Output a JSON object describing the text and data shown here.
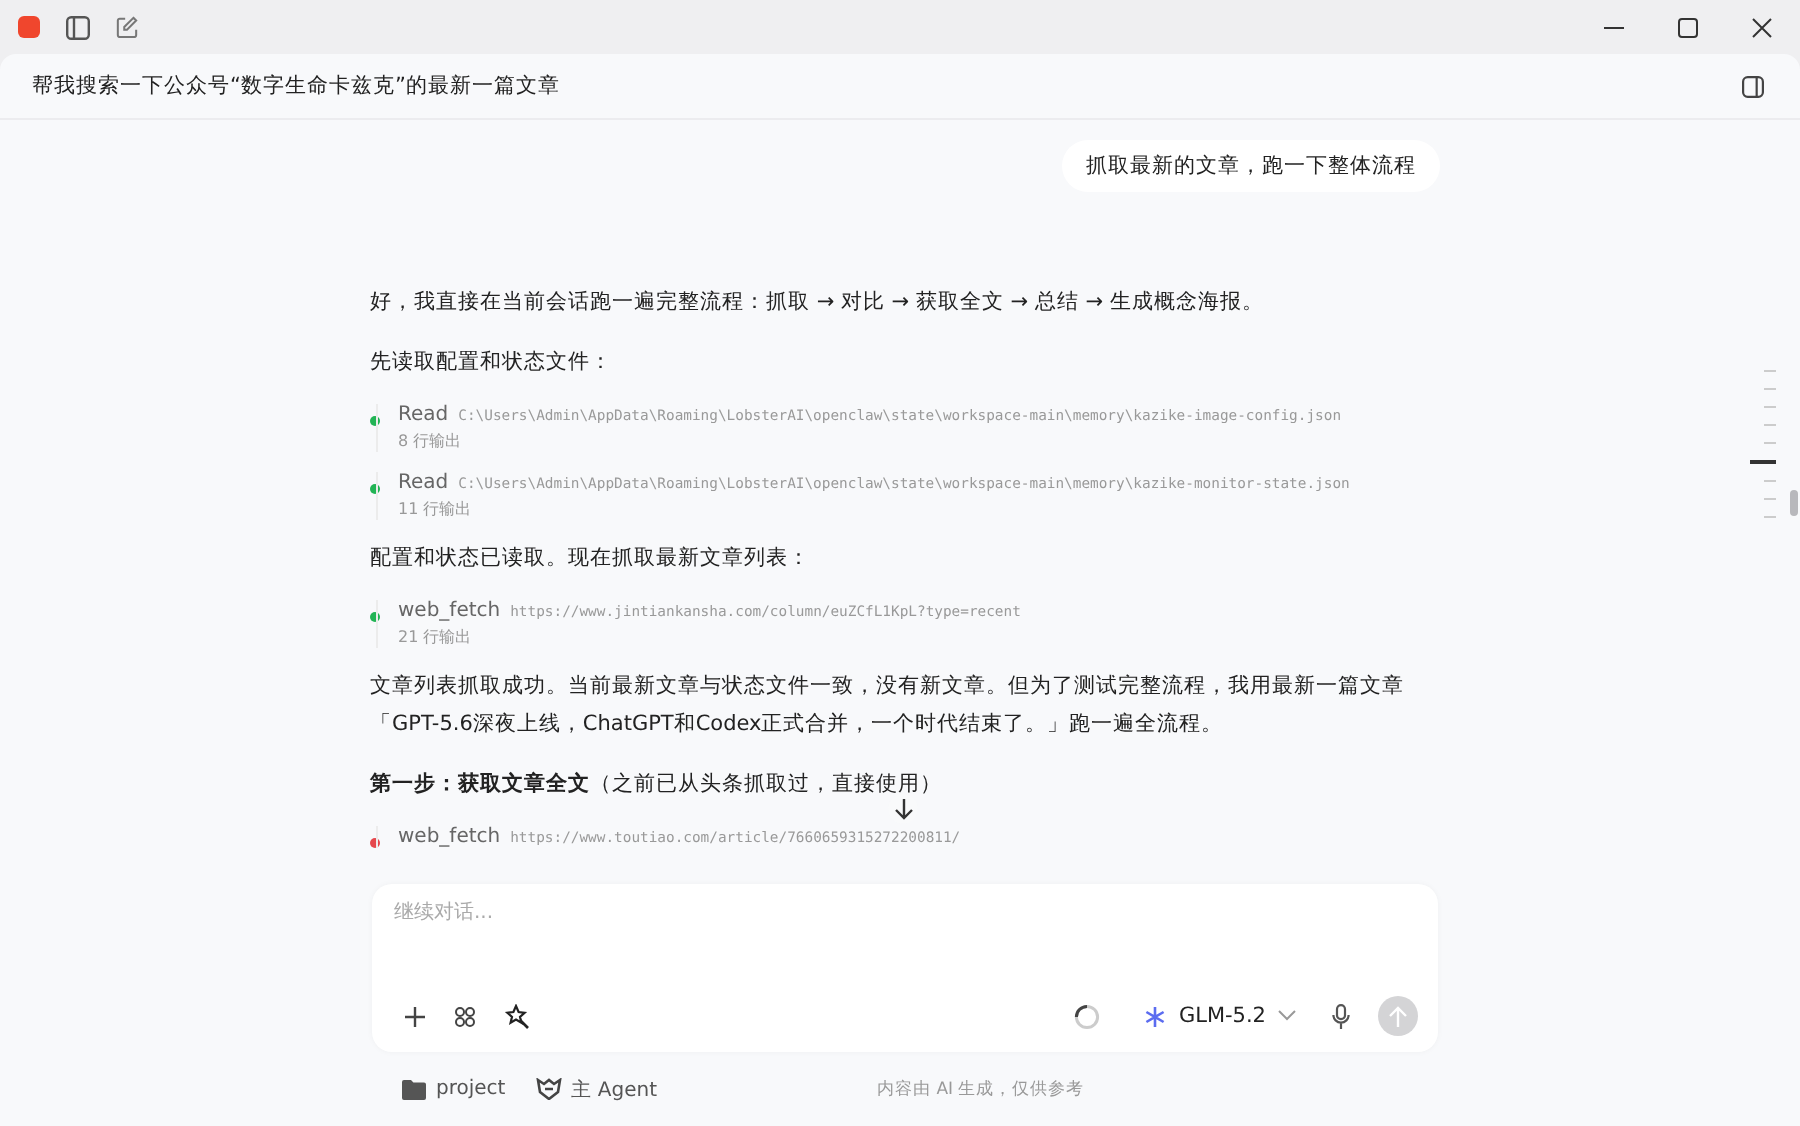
{
  "window": {
    "title": "帮我搜索一下公众号“数字生命卡兹克”的最新一篇文章"
  },
  "user_message": "抓取最新的文章，跑一下整体流程",
  "messages": [
    {
      "kind": "paragraph",
      "text": "好，我直接在当前会话跑一遍完整流程：抓取 → 对比 → 获取全文 → 总结 → 生成概念海报。"
    },
    {
      "kind": "paragraph",
      "text": "先读取配置和状态文件："
    },
    {
      "kind": "tool",
      "name": "Read",
      "target": "C:\\Users\\Admin\\AppData\\Roaming\\LobsterAI\\openclaw\\state\\workspace-main\\memory\\kazike-image-config.json",
      "output": "8 行输出",
      "color": "#22b455"
    },
    {
      "kind": "tool",
      "name": "Read",
      "target": "C:\\Users\\Admin\\AppData\\Roaming\\LobsterAI\\openclaw\\state\\workspace-main\\memory\\kazike-monitor-state.json",
      "output": "11 行输出",
      "color": "#22b455"
    },
    {
      "kind": "paragraph",
      "text": "配置和状态已读取。现在抓取最新文章列表："
    },
    {
      "kind": "tool",
      "name": "web_fetch",
      "target": "https://www.jintiankansha.com/column/euZCfL1KpL?type=recent",
      "output": "21 行输出",
      "color": "#22b455"
    },
    {
      "kind": "paragraph",
      "text": "文章列表抓取成功。当前最新文章与状态文件一致，没有新文章。但为了测试完整流程，我用最新一篇文章「GPT-5.6深夜上线，ChatGPT和Codex正式合并，一个时代结束了。」跑一遍全流程。"
    },
    {
      "kind": "paragraph",
      "text": "**第一步：获取文章全文**（之前已从头条抓取过，直接使用）"
    },
    {
      "kind": "tool",
      "name": "web_fetch",
      "target": "https://www.toutiao.com/article/7660659315272200811/",
      "color": "#e5484d"
    }
  ],
  "composer": {
    "placeholder": "继续对话...",
    "model": "GLM-5.2"
  },
  "footer": {
    "folder": "project",
    "agent": "主 Agent",
    "disclaimer": "内容由 AI 生成，仅供参考"
  }
}
